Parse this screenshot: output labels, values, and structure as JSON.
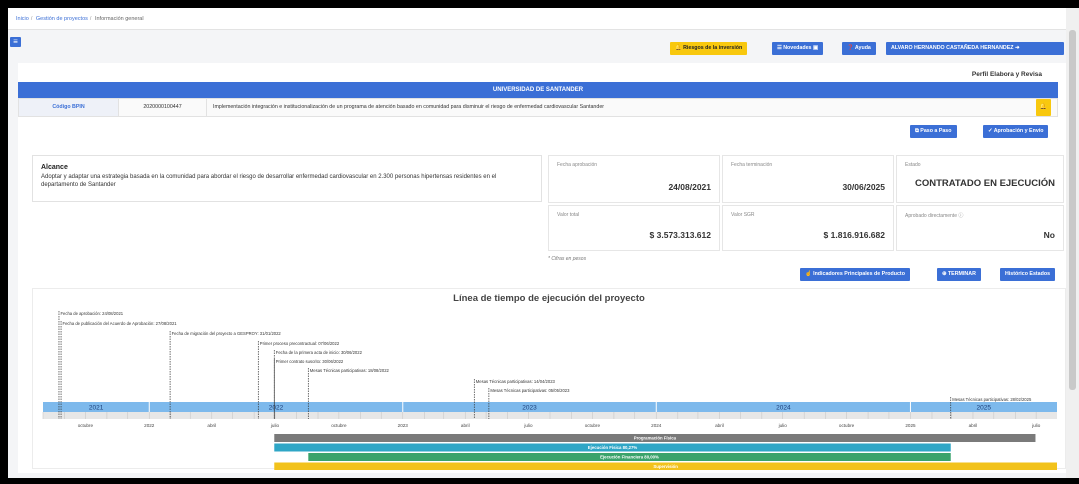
{
  "breadcrumb": {
    "home": "Inicio",
    "section": "Gestión de proyectos",
    "current": "Información general"
  },
  "topbar": {
    "riesgos": "Riesgos de la inversión",
    "novedades": "Novedades",
    "ayuda": "Ayuda",
    "user": "ALVARO HERNANDO CASTAÑEDA HERNANDEZ"
  },
  "perfil": "Perfil Elabora y Revisa",
  "university": "UNIVERSIDAD DE SANTANDER",
  "bpin": {
    "label": "Código BPIN",
    "code": "2020000100447",
    "description": "Implementación integración e institucionalización de un programa de atención basado en comunidad para disminuir el riesgo de enfermedad cardiovascular Santander"
  },
  "actions": {
    "paso": "Paso a Paso",
    "aprobacion": "Aprobación y Envío"
  },
  "alcance": {
    "title": "Alcance",
    "text": "Adoptar y adaptar una estrategia basada en la comunidad para abordar el riesgo de desarrollar enfermedad cardiovascular en 2.300 personas hipertensas residentes en el departamento de Santander"
  },
  "stats": {
    "fecha_aprobacion_label": "Fecha aprobación",
    "fecha_aprobacion": "24/08/2021",
    "fecha_terminacion_label": "Fecha terminación",
    "fecha_terminacion": "30/06/2025",
    "estado_label": "Estado",
    "estado": "CONTRATADO EN EJECUCIÓN",
    "valor_total_label": "Valor total",
    "valor_total": "$ 3.573.313.612",
    "valor_sgr_label": "Valor SGR",
    "valor_sgr": "$ 1.816.916.682",
    "aprobado_label": "Aprobado directamente",
    "aprobado": "No"
  },
  "cifras": "* Cifras en pesos",
  "buttons": {
    "indicadores": "Indicadores Principales de Producto",
    "terminar": "TERMINAR",
    "historico": "Histórico Estados"
  },
  "timeline": {
    "title": "Línea de tiempo de ejecución del proyecto",
    "events": [
      {
        "label": "Fecha de aprobación: 24/08/2021",
        "date": "2021-08-24"
      },
      {
        "label": "Fecha de publicación del Acuerdo de Aprobación: 27/08/2021",
        "date": "2021-08-27"
      },
      {
        "label": "Fecha de migración del proyecto a GESPROY: 31/01/2022",
        "date": "2022-01-31"
      },
      {
        "label": "Primer proceso precontractual: 07/06/2022",
        "date": "2022-06-07"
      },
      {
        "label": "Fecha de la primera acta de inicio: 30/06/2022",
        "date": "2022-06-30"
      },
      {
        "label": "Primer contrato suscrito: 30/06/2022",
        "date": "2022-06-30"
      },
      {
        "label": "Mesas Técnicas participativas: 18/08/2022",
        "date": "2022-08-18"
      },
      {
        "label": "Mesas Técnicas participativas: 14/04/2023",
        "date": "2023-04-14"
      },
      {
        "label": "Mesas Técnicas participativas: 05/05/2023",
        "date": "2023-05-05"
      },
      {
        "label": "Mesas Técnicas participativas: 28/02/2025",
        "date": "2025-02-28"
      }
    ],
    "years": [
      "2021",
      "2022",
      "2023",
      "2024",
      "2025"
    ],
    "ticks": [
      {
        "label": "octubre",
        "date": "2021-10-01"
      },
      {
        "label": "2022",
        "date": "2022-01-01"
      },
      {
        "label": "abril",
        "date": "2022-04-01"
      },
      {
        "label": "julio",
        "date": "2022-07-01"
      },
      {
        "label": "octubre",
        "date": "2022-10-01"
      },
      {
        "label": "2023",
        "date": "2023-01-01"
      },
      {
        "label": "abril",
        "date": "2023-04-01"
      },
      {
        "label": "julio",
        "date": "2023-07-01"
      },
      {
        "label": "octubre",
        "date": "2023-10-01"
      },
      {
        "label": "2024",
        "date": "2024-01-01"
      },
      {
        "label": "abril",
        "date": "2024-04-01"
      },
      {
        "label": "julio",
        "date": "2024-07-01"
      },
      {
        "label": "octubre",
        "date": "2024-10-01"
      },
      {
        "label": "2025",
        "date": "2025-01-01"
      },
      {
        "label": "abril",
        "date": "2025-04-01"
      },
      {
        "label": "julio",
        "date": "2025-07-01"
      }
    ],
    "bars": [
      {
        "label": "Programación Física",
        "start": "2022-06-30",
        "end": "2025-06-30",
        "color": "#7a7a7a"
      },
      {
        "label": "Ejecución Física 80,27%",
        "start": "2022-06-30",
        "end": "2025-02-28",
        "color": "#2fa6c6"
      },
      {
        "label": "Ejecución Financiera 80,00%",
        "start": "2022-08-18",
        "end": "2025-02-28",
        "color": "#3aa36b"
      },
      {
        "label": "Supervisión",
        "start": "2022-06-30",
        "end": "2025-07-31",
        "color": "#f2c21b"
      }
    ]
  },
  "colors": {
    "primary": "#3b6fd6",
    "warning": "#f8c80e",
    "timeline_band": "#7db9ec"
  }
}
